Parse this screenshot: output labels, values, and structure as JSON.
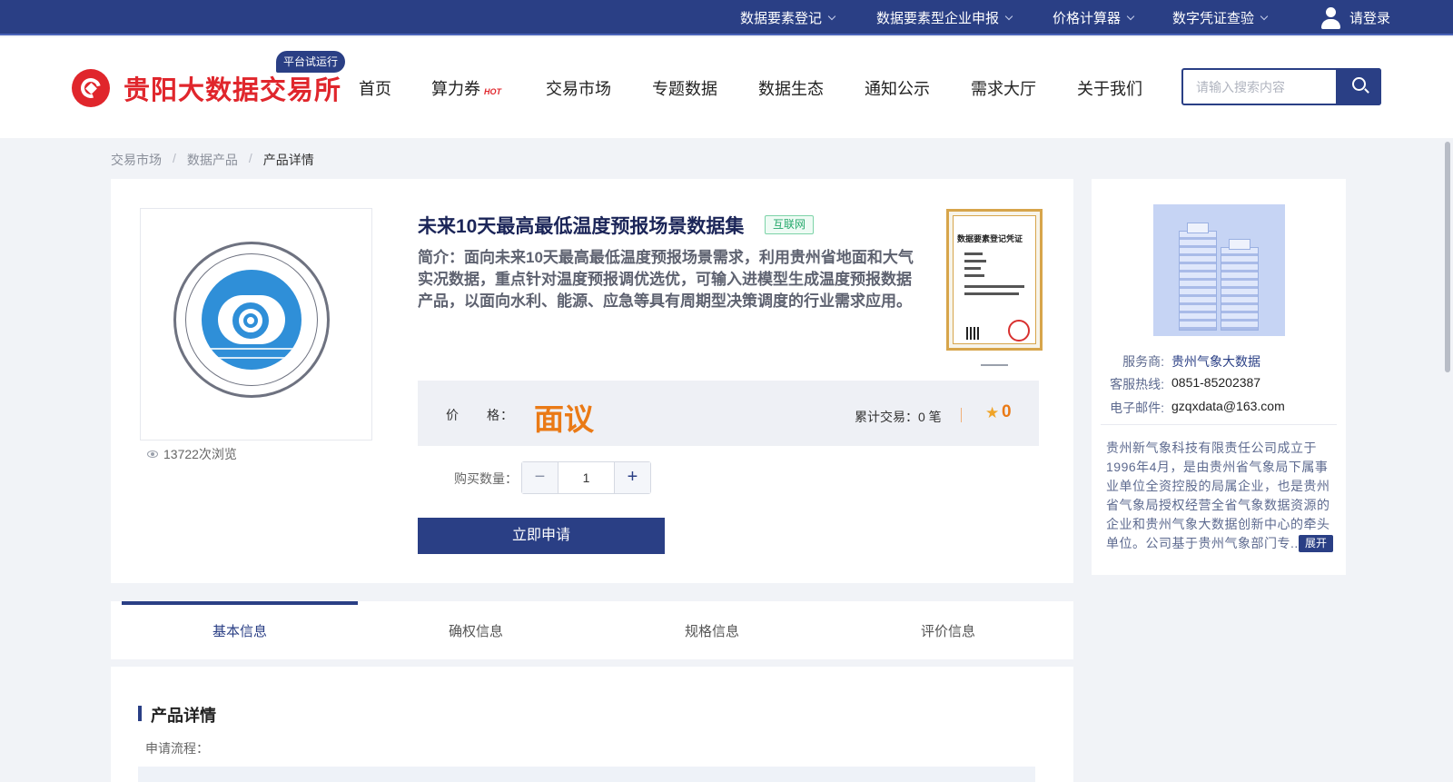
{
  "topbar": {
    "menus": [
      "数据要素登记",
      "数据要素型企业申报",
      "价格计算器",
      "数字凭证查验"
    ],
    "login": "请登录"
  },
  "header": {
    "brand": "贵阳大数据交易所",
    "badge": "平台试运行",
    "nav": [
      "首页",
      "算力券",
      "交易市场",
      "专题数据",
      "数据生态",
      "通知公示",
      "需求大厅",
      "关于我们"
    ],
    "hot_label": "HOT",
    "search_placeholder": "请输入搜索内容"
  },
  "breadcrumb": [
    "交易市场",
    "数据产品",
    "产品详情"
  ],
  "product": {
    "title": "未来10天最高最低温度预报场景数据集",
    "tag": "互联网",
    "description": "简介：面向未来10天最高最低温度预报场景需求，利用贵州省地面和大气实况数据，重点针对温度预报调优选优，可输入进模型生成温度预报数据产品，以面向水利、能源、应急等具有周期型决策调度的行业需求应用。",
    "views": "13722次浏览",
    "certificate_title": "数据要素登记凭证",
    "price_label": "价　　格：",
    "price": "面议",
    "trade_count": "累计交易：0 笔",
    "rating": "0",
    "quantity_label": "购买数量：",
    "quantity": "1",
    "apply_label": "立即申请"
  },
  "provider": {
    "service_label": "服务商:",
    "service_value": "贵州气象大数据",
    "hotline_label": "客服热线:",
    "hotline_value": "0851-85202387",
    "email_label": "电子邮件:",
    "email_value": "gzqxdata@163.com",
    "description": "贵州新气象科技有限责任公司成立于1996年4月，是由贵州省气象局下属事业单位全资控股的局属企业，也是贵州省气象局授权经营全省气象数据资源的企业和贵州气象大数据创新中心的牵头单位。公司基于贵州气象部门专...",
    "expand_label": "展开"
  },
  "tabs": [
    "基本信息",
    "确权信息",
    "规格信息",
    "评价信息"
  ],
  "detail": {
    "title": "产品详情",
    "subtitle": "申请流程："
  },
  "colors": {
    "brand_navy": "#2a3f85",
    "brand_red": "#e0262c",
    "price_orange": "#ea7a16"
  }
}
